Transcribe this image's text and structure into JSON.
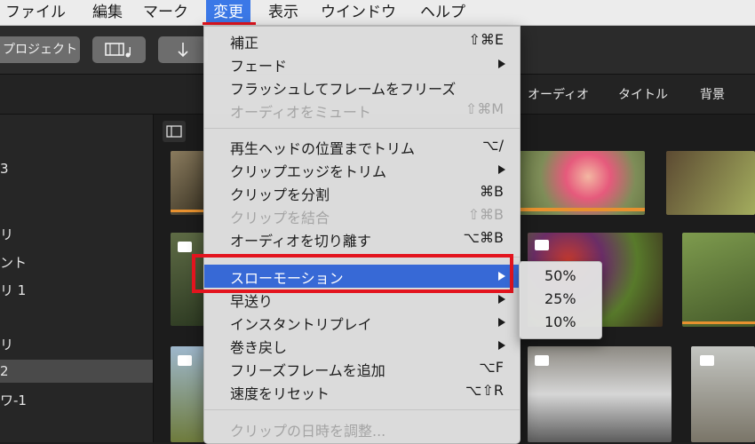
{
  "menubar": {
    "items": [
      "ファイル",
      "編集",
      "マーク",
      "変更",
      "表示",
      "ウインドウ",
      "ヘルプ"
    ],
    "active": "変更"
  },
  "toolbar": {
    "project_label": "プロジェクト",
    "media_icon": "film-music-icon",
    "import_icon": "down-arrow-icon"
  },
  "tabs": [
    "オーディオ",
    "タイトル",
    "背景"
  ],
  "sidebar": {
    "items": [
      "3",
      "リ",
      "ント",
      "リ 1",
      "リ",
      "2",
      "ワ-1"
    ],
    "selected_index": 5
  },
  "menu": {
    "items": [
      {
        "label": "補正",
        "shortcut": "⇧⌘E",
        "disabled": false,
        "submenu": false
      },
      {
        "label": "フェード",
        "shortcut": "",
        "disabled": false,
        "submenu": true
      },
      {
        "label": "フラッシュしてフレームをフリーズ",
        "shortcut": "",
        "disabled": false,
        "submenu": false
      },
      {
        "label": "オーディオをミュート",
        "shortcut": "⇧⌘M",
        "disabled": true,
        "submenu": false
      },
      {
        "label": "再生ヘッドの位置までトリム",
        "shortcut": "⌥/",
        "disabled": false,
        "submenu": false
      },
      {
        "label": "クリップエッジをトリム",
        "shortcut": "",
        "disabled": false,
        "submenu": true
      },
      {
        "label": "クリップを分割",
        "shortcut": "⌘B",
        "disabled": false,
        "submenu": false
      },
      {
        "label": "クリップを結合",
        "shortcut": "⇧⌘B",
        "disabled": true,
        "submenu": false
      },
      {
        "label": "オーディオを切り離す",
        "shortcut": "⌥⌘B",
        "disabled": false,
        "submenu": false
      },
      {
        "label": "スローモーション",
        "shortcut": "",
        "disabled": false,
        "submenu": true,
        "highlighted": true
      },
      {
        "label": "早送り",
        "shortcut": "",
        "disabled": false,
        "submenu": true
      },
      {
        "label": "インスタントリプレイ",
        "shortcut": "",
        "disabled": false,
        "submenu": true
      },
      {
        "label": "巻き戻し",
        "shortcut": "",
        "disabled": false,
        "submenu": true
      },
      {
        "label": "フリーズフレームを追加",
        "shortcut": "⌥F",
        "disabled": false,
        "submenu": false
      },
      {
        "label": "速度をリセット",
        "shortcut": "⌥⇧R",
        "disabled": false,
        "submenu": false
      },
      {
        "label": "クリップの日時を調整...",
        "shortcut": "",
        "disabled": true,
        "submenu": false
      }
    ]
  },
  "submenu": {
    "items": [
      "50%",
      "25%",
      "10%"
    ]
  },
  "colors": {
    "highlight": "#3769d6",
    "annotation": "#e3141e",
    "menu_bg": "#e2e2e2"
  }
}
